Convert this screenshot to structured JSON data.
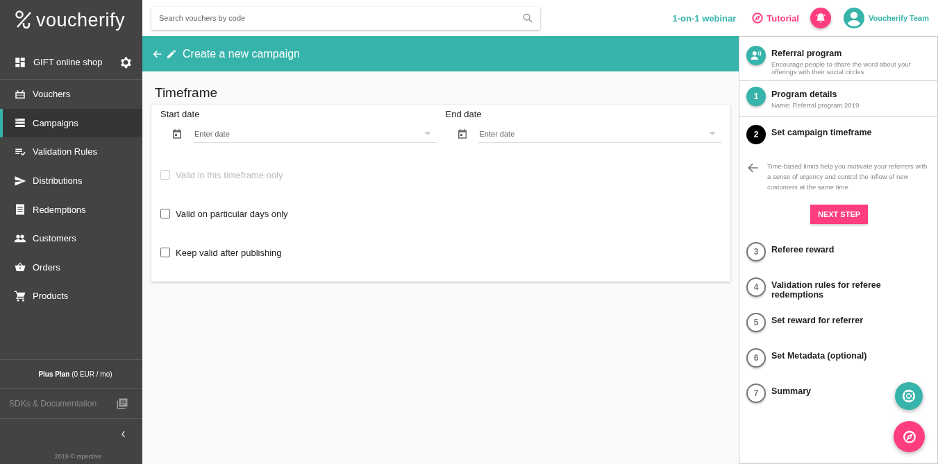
{
  "logo": {
    "text": "voucherify"
  },
  "sidebar": {
    "project": "GIFT online shop",
    "items": [
      {
        "label": "Vouchers",
        "selected": false
      },
      {
        "label": "Campaigns",
        "selected": true
      },
      {
        "label": "Validation Rules",
        "selected": false
      },
      {
        "label": "Distributions",
        "selected": false
      },
      {
        "label": "Redemptions",
        "selected": false
      },
      {
        "label": "Customers",
        "selected": false
      },
      {
        "label": "Orders",
        "selected": false
      },
      {
        "label": "Products",
        "selected": false
      }
    ],
    "plan": "**Plus Plan** (0 EUR / mo)",
    "docs": "SDKs & Documentation",
    "collapse": "‹",
    "footer": "2019 © rspective"
  },
  "topbar": {
    "search": {
      "placeholder": "Search vouchers by code"
    },
    "webinar": "1-on-1 webinar",
    "tutorial": "Tutorial",
    "user": "Voucherify Team"
  },
  "header": {
    "title": "Create a new campaign"
  },
  "section": {
    "title": "Timeframe",
    "dates": [
      {
        "label": "Start date",
        "placeholder": "Enter date"
      },
      {
        "label": "End date",
        "placeholder": "Enter date"
      }
    ],
    "checkboxes": [
      {
        "label": "Valid in this timeframe only",
        "checked": false,
        "disabled": true
      },
      {
        "label": "Valid on particular days only",
        "checked": false,
        "disabled": false
      },
      {
        "label": "Keep valid after publishing",
        "checked": false,
        "disabled": false
      }
    ]
  },
  "steps": [
    {
      "kind": "intro",
      "title": "Referral program",
      "subtitle": "Encourage people to share the word about your offerings with their social circles"
    },
    {
      "kind": "done",
      "number": "1",
      "title": "Program details",
      "subtitle": "Name: Referral program 2019"
    },
    {
      "kind": "active",
      "number": "2",
      "title": "Set campaign timeframe",
      "description": "Time-based limits help you motivate your referrers with a sense of urgency and control the inflow of new customers at the same time",
      "button": "NEXT STEP"
    },
    {
      "kind": "pending",
      "number": "3",
      "title": "Referee reward"
    },
    {
      "kind": "pending",
      "number": "4",
      "title": "Validation rules for referee redemptions"
    },
    {
      "kind": "pending",
      "number": "5",
      "title": "Set reward for referrer"
    },
    {
      "kind": "pending",
      "number": "6",
      "title": "Set Metadata (optional)"
    },
    {
      "kind": "pending",
      "number": "7",
      "title": "Summary"
    }
  ]
}
